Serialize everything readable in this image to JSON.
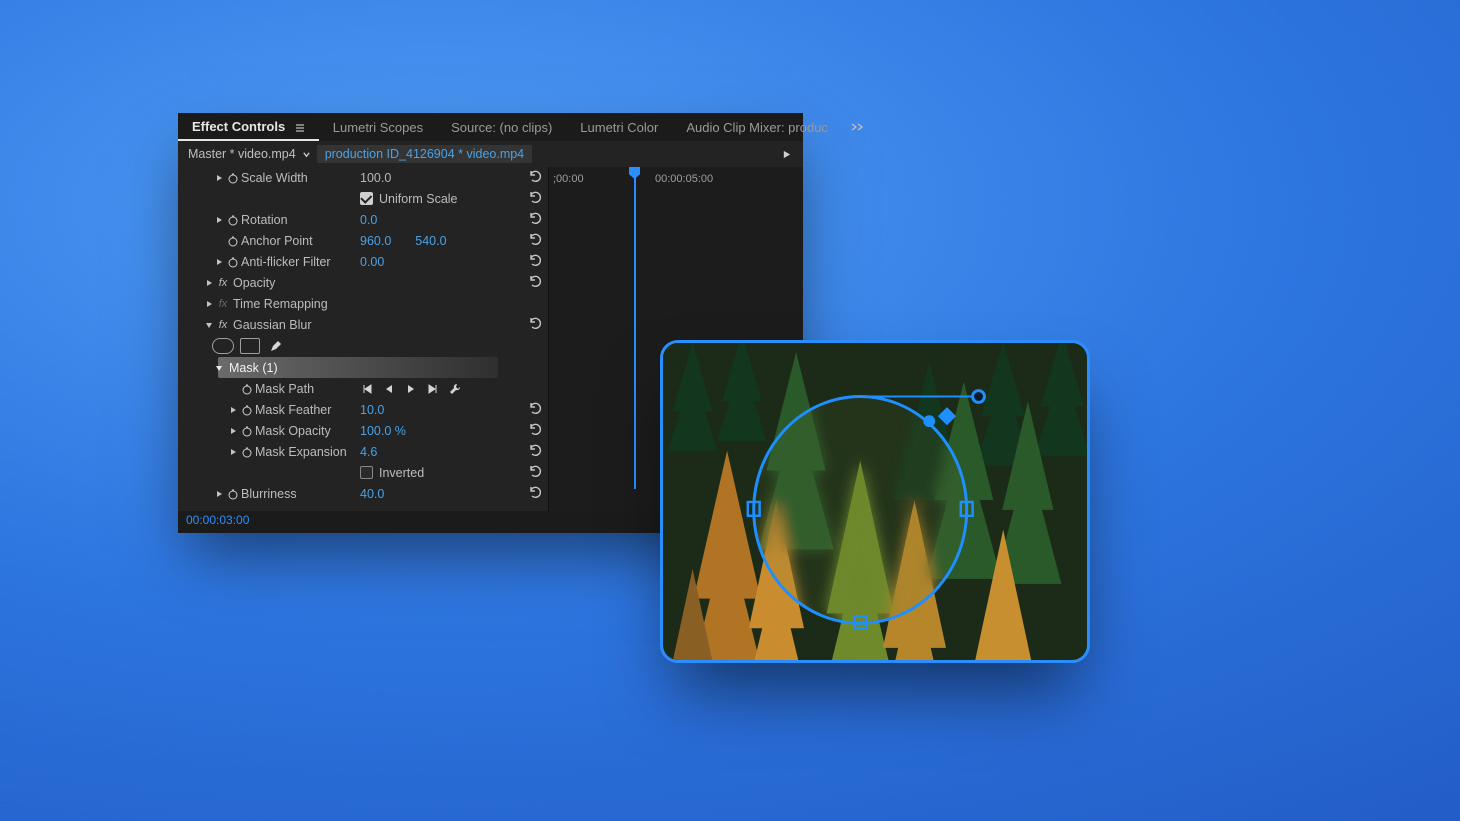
{
  "tabs": {
    "effect_controls": "Effect Controls",
    "lumetri_scopes": "Lumetri Scopes",
    "source": "Source: (no clips)",
    "lumetri_color": "Lumetri Color",
    "audio_clip_mixer": "Audio Clip Mixer: produc"
  },
  "breadcrumb": {
    "master": "Master * video.mp4",
    "clip": "production ID_4126904 * video.mp4"
  },
  "timecodes": {
    "left": ";00:00",
    "right": "00:00:05:00",
    "footer": "00:00:03:00"
  },
  "properties": {
    "scale_width": {
      "label": "Scale Width",
      "value": "100.0"
    },
    "uniform_scale": {
      "label": "Uniform Scale"
    },
    "rotation": {
      "label": "Rotation",
      "value": "0.0"
    },
    "anchor_point": {
      "label": "Anchor Point",
      "x": "960.0",
      "y": "540.0"
    },
    "anti_flicker": {
      "label": "Anti-flicker Filter",
      "value": "0.00"
    },
    "opacity": {
      "label": "Opacity"
    },
    "time_remapping": {
      "label": "Time Remapping"
    },
    "gaussian_blur": {
      "label": "Gaussian Blur"
    },
    "mask": {
      "label": "Mask (1)"
    },
    "mask_path": {
      "label": "Mask Path"
    },
    "mask_feather": {
      "label": "Mask Feather",
      "value": "10.0"
    },
    "mask_opacity": {
      "label": "Mask Opacity",
      "value": "100.0 %"
    },
    "mask_expansion": {
      "label": "Mask Expansion",
      "value": "4.6"
    },
    "inverted": {
      "label": "Inverted"
    },
    "blurriness": {
      "label": "Blurriness",
      "value": "40.0"
    }
  }
}
